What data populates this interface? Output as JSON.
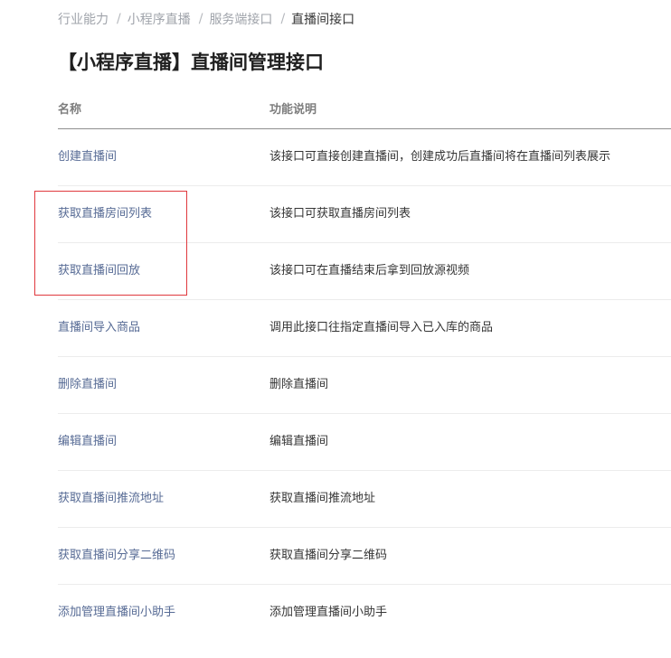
{
  "breadcrumb": {
    "items": [
      "行业能力",
      "小程序直播",
      "服务端接口"
    ],
    "current": "直播间接口",
    "separator": "/"
  },
  "page": {
    "title": "【小程序直播】直播间管理接口"
  },
  "table": {
    "headers": {
      "name": "名称",
      "description": "功能说明"
    },
    "rows": [
      {
        "name": "创建直播间",
        "description": "该接口可直接创建直播间，创建成功后直播间将在直播间列表展示"
      },
      {
        "name": "获取直播房间列表",
        "description": "该接口可获取直播房间列表"
      },
      {
        "name": "获取直播间回放",
        "description": "该接口可在直播结束后拿到回放源视频"
      },
      {
        "name": "直播间导入商品",
        "description": "调用此接口往指定直播间导入已入库的商品"
      },
      {
        "name": "删除直播间",
        "description": "删除直播间"
      },
      {
        "name": "编辑直播间",
        "description": "编辑直播间"
      },
      {
        "name": "获取直播间推流地址",
        "description": "获取直播间推流地址"
      },
      {
        "name": "获取直播间分享二维码",
        "description": "获取直播间分享二维码"
      },
      {
        "name": "添加管理直播间小助手",
        "description": "添加管理直播间小助手"
      }
    ]
  },
  "colors": {
    "link": "#576b95",
    "highlight_border": "#e0393e",
    "header_border": "#8e8e8e",
    "row_border": "#ececec"
  }
}
